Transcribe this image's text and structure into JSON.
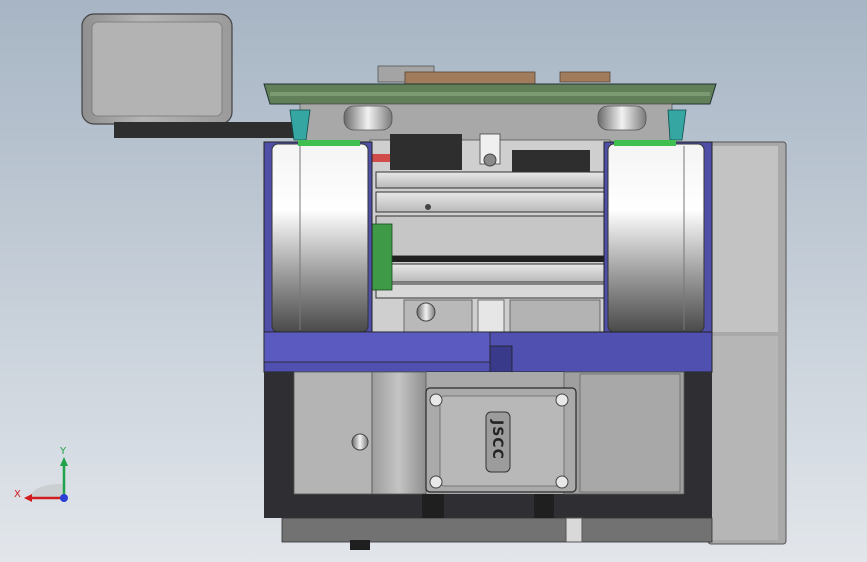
{
  "colors": {
    "background_top": "#aab8c6",
    "background_bottom": "#dfe4ea",
    "blue_frame": "#4f4fa8",
    "dark_frame": "#2f2f33",
    "pcb_green": "#5f7f55",
    "connector_green": "#3f9a48",
    "teal_clip": "#36a6a2",
    "axis_x": "#d01c1c",
    "axis_y": "#1fa24a",
    "axis_z": "#2b3fd6"
  },
  "part": {
    "motor_label": "JSCC"
  },
  "triad": {
    "x_label": "X",
    "y_label": "Y"
  }
}
